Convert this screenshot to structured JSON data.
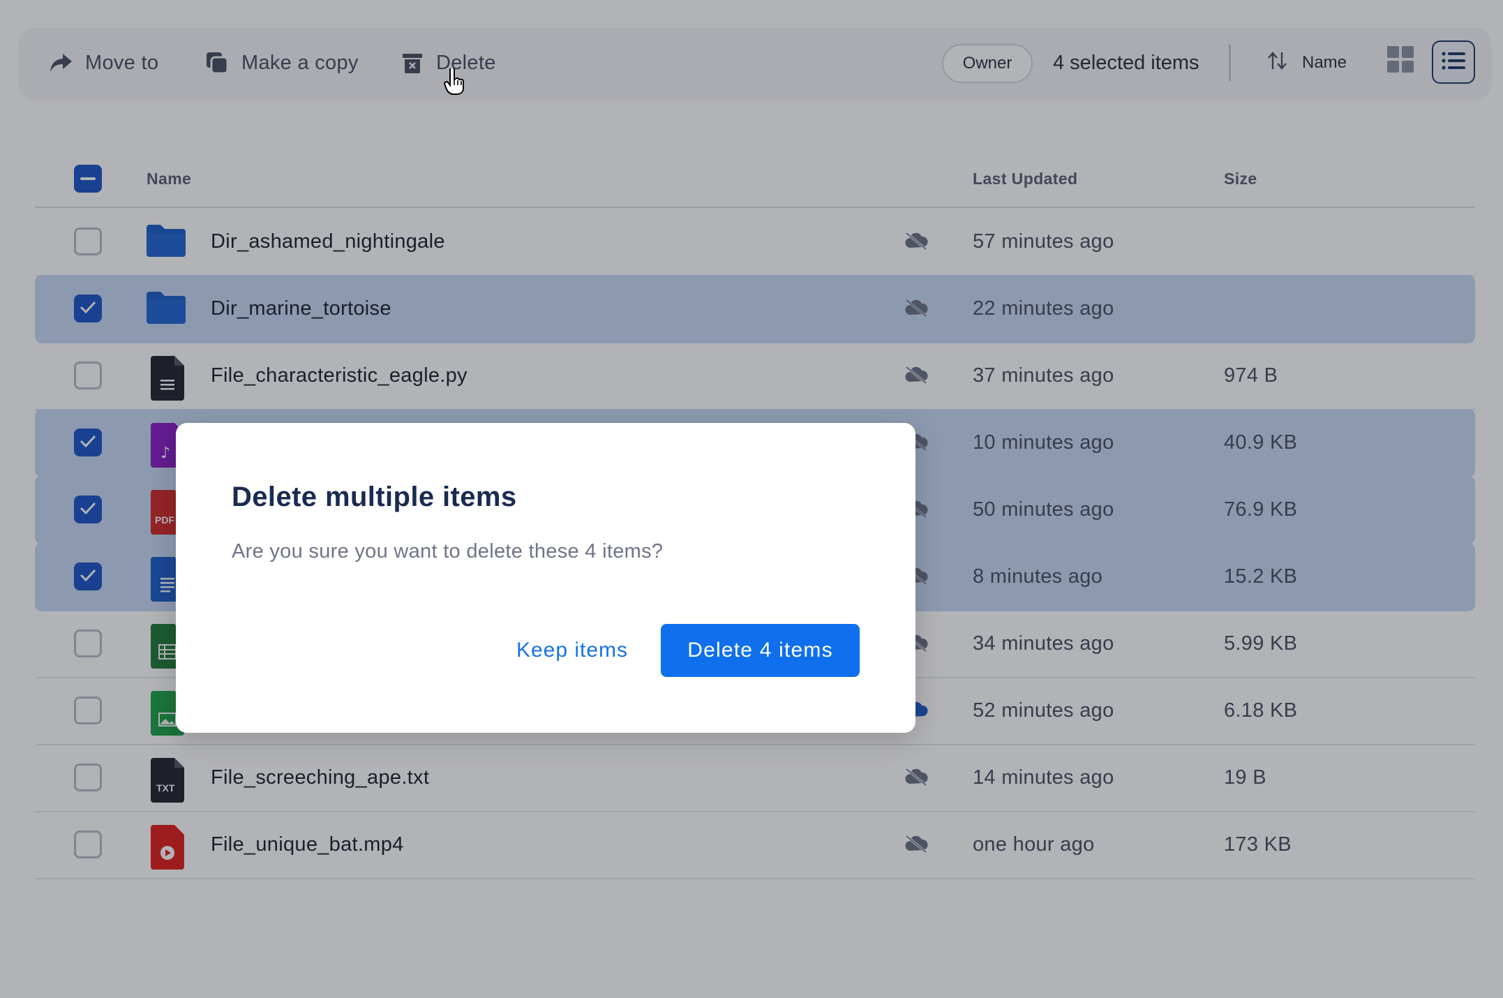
{
  "toolbar": {
    "move_label": "Move to",
    "copy_label": "Make a copy",
    "delete_label": "Delete",
    "owner_filter": "Owner",
    "selection_count": "4 selected items",
    "sort_label": "Name"
  },
  "table": {
    "headers": {
      "name": "Name",
      "updated": "Last Updated",
      "size": "Size"
    },
    "rows": [
      {
        "name": "Dir_ashamed_nightingale",
        "updated": "57 minutes ago",
        "size": "",
        "selected": false,
        "icon": "folder-icon",
        "cloud": "cloud-off-icon"
      },
      {
        "name": "Dir_marine_tortoise",
        "updated": "22 minutes ago",
        "size": "",
        "selected": true,
        "icon": "folder-icon",
        "cloud": "cloud-off-icon"
      },
      {
        "name": "File_characteristic_eagle.py",
        "updated": "37 minutes ago",
        "size": "974 B",
        "selected": false,
        "icon": "code-file-icon",
        "cloud": "cloud-off-icon"
      },
      {
        "name": "",
        "updated": "10 minutes ago",
        "size": "40.9 KB",
        "selected": true,
        "icon": "audio-file-icon",
        "cloud": "cloud-off-icon"
      },
      {
        "name": "",
        "updated": "50 minutes ago",
        "size": "76.9 KB",
        "selected": true,
        "icon": "pdf-file-icon",
        "badge": "PDF",
        "cloud": "cloud-off-icon"
      },
      {
        "name": "",
        "updated": "8 minutes ago",
        "size": "15.2 KB",
        "selected": true,
        "icon": "document-file-icon",
        "cloud": "cloud-off-icon"
      },
      {
        "name": "",
        "updated": "34 minutes ago",
        "size": "5.99 KB",
        "selected": false,
        "icon": "spreadsheet-file-icon",
        "cloud": "cloud-off-icon"
      },
      {
        "name": "",
        "updated": "52 minutes ago",
        "size": "6.18 KB",
        "selected": false,
        "icon": "image-file-icon",
        "cloud": "cloud-synced-icon"
      },
      {
        "name": "File_screeching_ape.txt",
        "updated": "14 minutes ago",
        "size": "19 B",
        "selected": false,
        "icon": "text-file-icon",
        "badge": "TXT",
        "cloud": "cloud-off-icon"
      },
      {
        "name": "File_unique_bat.mp4",
        "updated": "one hour ago",
        "size": "173 KB",
        "selected": false,
        "icon": "video-file-icon",
        "cloud": "cloud-off-icon"
      }
    ]
  },
  "dialog": {
    "title": "Delete multiple items",
    "message": "Are you sure you want to delete these 4 items?",
    "cancel_label": "Keep items",
    "confirm_label": "Delete 4 items"
  },
  "colors": {
    "accent": "#0f6fed",
    "selected_row": "#c6d8f5",
    "checkbox": "#1d56c8",
    "folder": "#1d5fc9",
    "audio": "#8a1fc7",
    "pdf": "#d42a2a",
    "document": "#1d5fc9",
    "spreadsheet": "#1e7d3a",
    "image": "#1fa34a",
    "video": "#e0201f"
  }
}
